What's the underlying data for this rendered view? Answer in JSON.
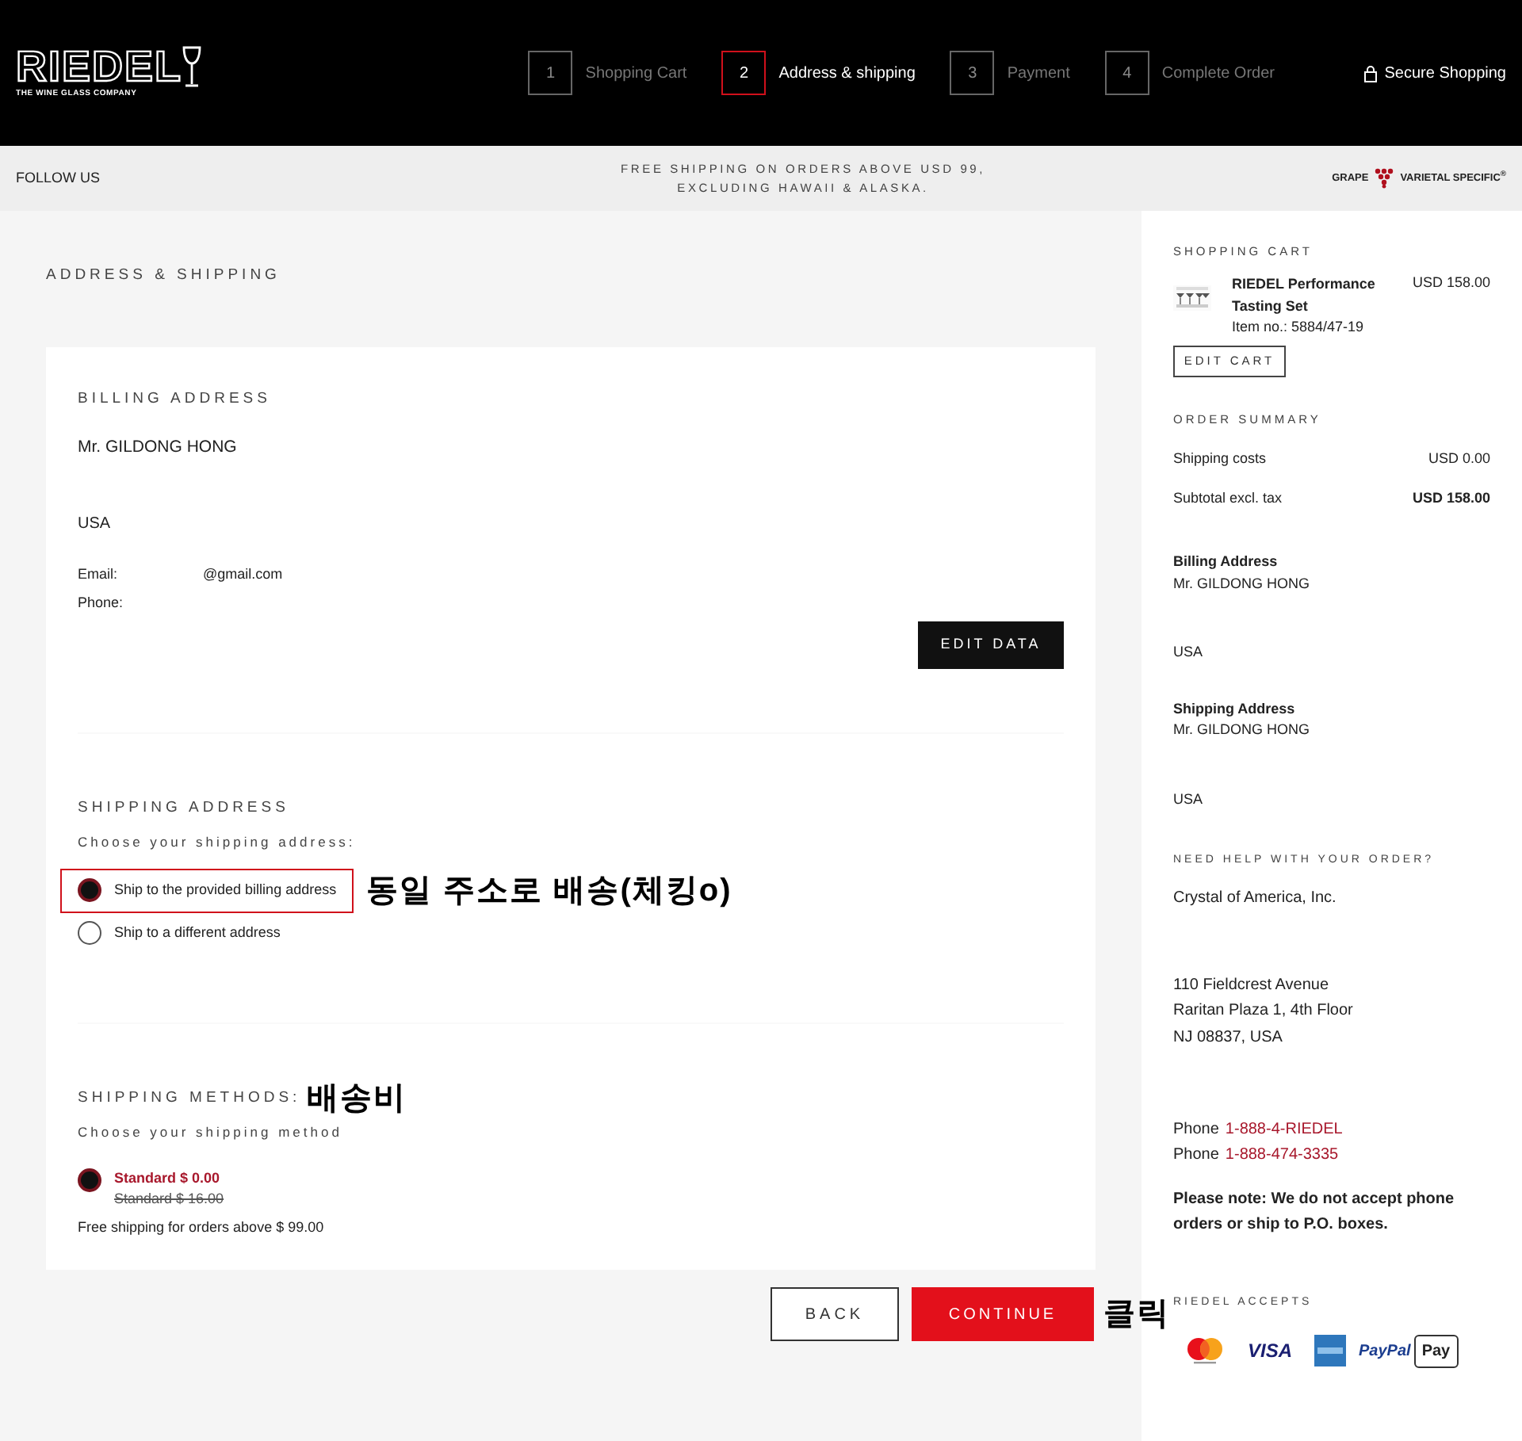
{
  "header": {
    "logo": {
      "name": "RIEDEL",
      "tagline": "THE WINE GLASS COMPANY"
    },
    "steps": [
      {
        "number": "1",
        "label": "Shopping Cart",
        "selected": false
      },
      {
        "number": "2",
        "label": "Address & shipping",
        "selected": true
      },
      {
        "number": "3",
        "label": "Payment",
        "selected": false
      },
      {
        "number": "4",
        "label": "Complete Order",
        "selected": false
      }
    ],
    "secure": "Secure Shopping"
  },
  "strip": {
    "follow": "FOLLOW US",
    "notice": "FREE SHIPPING ON ORDERS ABOVE USD 99, EXCLUDING HAWAII & ALASKA.",
    "brand_left": "GRAPE",
    "brand_right": "VARIETAL SPECIFIC$^{®}$"
  },
  "main": {
    "title": "ADDRESS & SHIPPING",
    "billing": {
      "heading": "BILLING ADDRESS",
      "name": "Mr. GILDONG HONG",
      "country": "USA",
      "email_label": "Email:",
      "email_value": "@gmail.com",
      "phone_label": "Phone:",
      "button": "EDIT DATA"
    },
    "shipping_address": {
      "heading": "SHIPPING ADDRESS",
      "prompt": "Choose your shipping address:",
      "options": [
        {
          "label": "Ship to the provided billing address",
          "selected": true,
          "highlighted": true,
          "annotation": "동일 주소로 배송(체킹o)"
        },
        {
          "label": "Ship to a different address",
          "selected": false,
          "highlighted": false
        }
      ]
    },
    "shipping_methods": {
      "heading": "SHIPPING METHODS:",
      "annotation": "배송비",
      "prompt": "Choose your shipping method",
      "options": [
        {
          "label": "Standard $ 0.00",
          "old_price": "Standard $ 16.00",
          "selected": true
        }
      ],
      "note": "Free shipping for orders above $ 99.00"
    },
    "back": "BACK",
    "continue": "CONTINUE",
    "continue_annotation": "클릭"
  },
  "sidebar": {
    "cart": {
      "heading": "SHOPPING CART",
      "items": [
        {
          "kind": "picture",
          "name": "RIEDEL Performance Tasting Set",
          "item_no": "Item no.: 5884/47-19",
          "price": "USD 158.00"
        }
      ],
      "button": "EDIT CART"
    },
    "summary": {
      "heading": "ORDER SUMMARY",
      "rows": [
        {
          "label": "Shipping costs",
          "value": "USD 0.00",
          "bold": false
        },
        {
          "label": "Subtotal excl. tax",
          "value": "USD 158.00",
          "bold": true
        }
      ]
    },
    "billing": {
      "heading": "Billing Address",
      "name": "Mr. GILDONG HONG",
      "country": "USA"
    },
    "shipping": {
      "heading": "Shipping Address",
      "name": "Mr. GILDONG HONG",
      "country": "USA"
    },
    "help": {
      "heading": "NEED HELP WITH YOUR ORDER?",
      "company": "Crystal of America, Inc.",
      "address": [
        "110 Fieldcrest Avenue",
        "Raritan Plaza 1, 4th Floor",
        "NJ 08837, USA"
      ],
      "phones": [
        {
          "label": "Phone",
          "number": "1-888-4-RIEDEL"
        },
        {
          "label": "Phone",
          "number": "1-888-474-3335"
        }
      ],
      "note": "Please note: We do not accept phone orders or ship to P.O. boxes."
    },
    "accepts": {
      "heading": "RIEDEL ACCEPTS",
      "methods": [
        {
          "kind": "mastercard"
        },
        {
          "kind": "visa",
          "text": "VISA"
        },
        {
          "kind": "amex"
        },
        {
          "kind": "paypal",
          "text": "PayPal"
        },
        {
          "kind": "applepay",
          "text": "Pay"
        }
      ]
    }
  }
}
